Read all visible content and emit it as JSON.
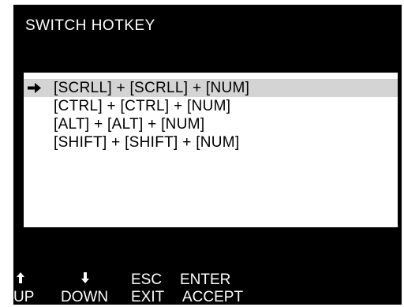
{
  "screen": {
    "title": "SWITCH HOTKEY",
    "background_color": "#000000",
    "text_color": "#ffffff"
  },
  "menu": {
    "selected_index": 0,
    "selection_icon": "right-arrow-icon",
    "highlight_color": "#d4d4d4",
    "items": [
      {
        "label": "[SCRLL] + [SCRLL] + [NUM]"
      },
      {
        "label": "[CTRL] + [CTRL] + [NUM]"
      },
      {
        "label": "[ALT] + [ALT] + [NUM]"
      },
      {
        "label": "[SHIFT] + [SHIFT] + [NUM]"
      }
    ]
  },
  "footer": {
    "up": {
      "icon": "up-arrow-icon",
      "label": "UP"
    },
    "down": {
      "icon": "down-arrow-icon",
      "label": "DOWN"
    },
    "esc": {
      "key": "ESC",
      "label": "EXIT"
    },
    "enter": {
      "key": "ENTER",
      "label": "ACCEPT"
    }
  }
}
